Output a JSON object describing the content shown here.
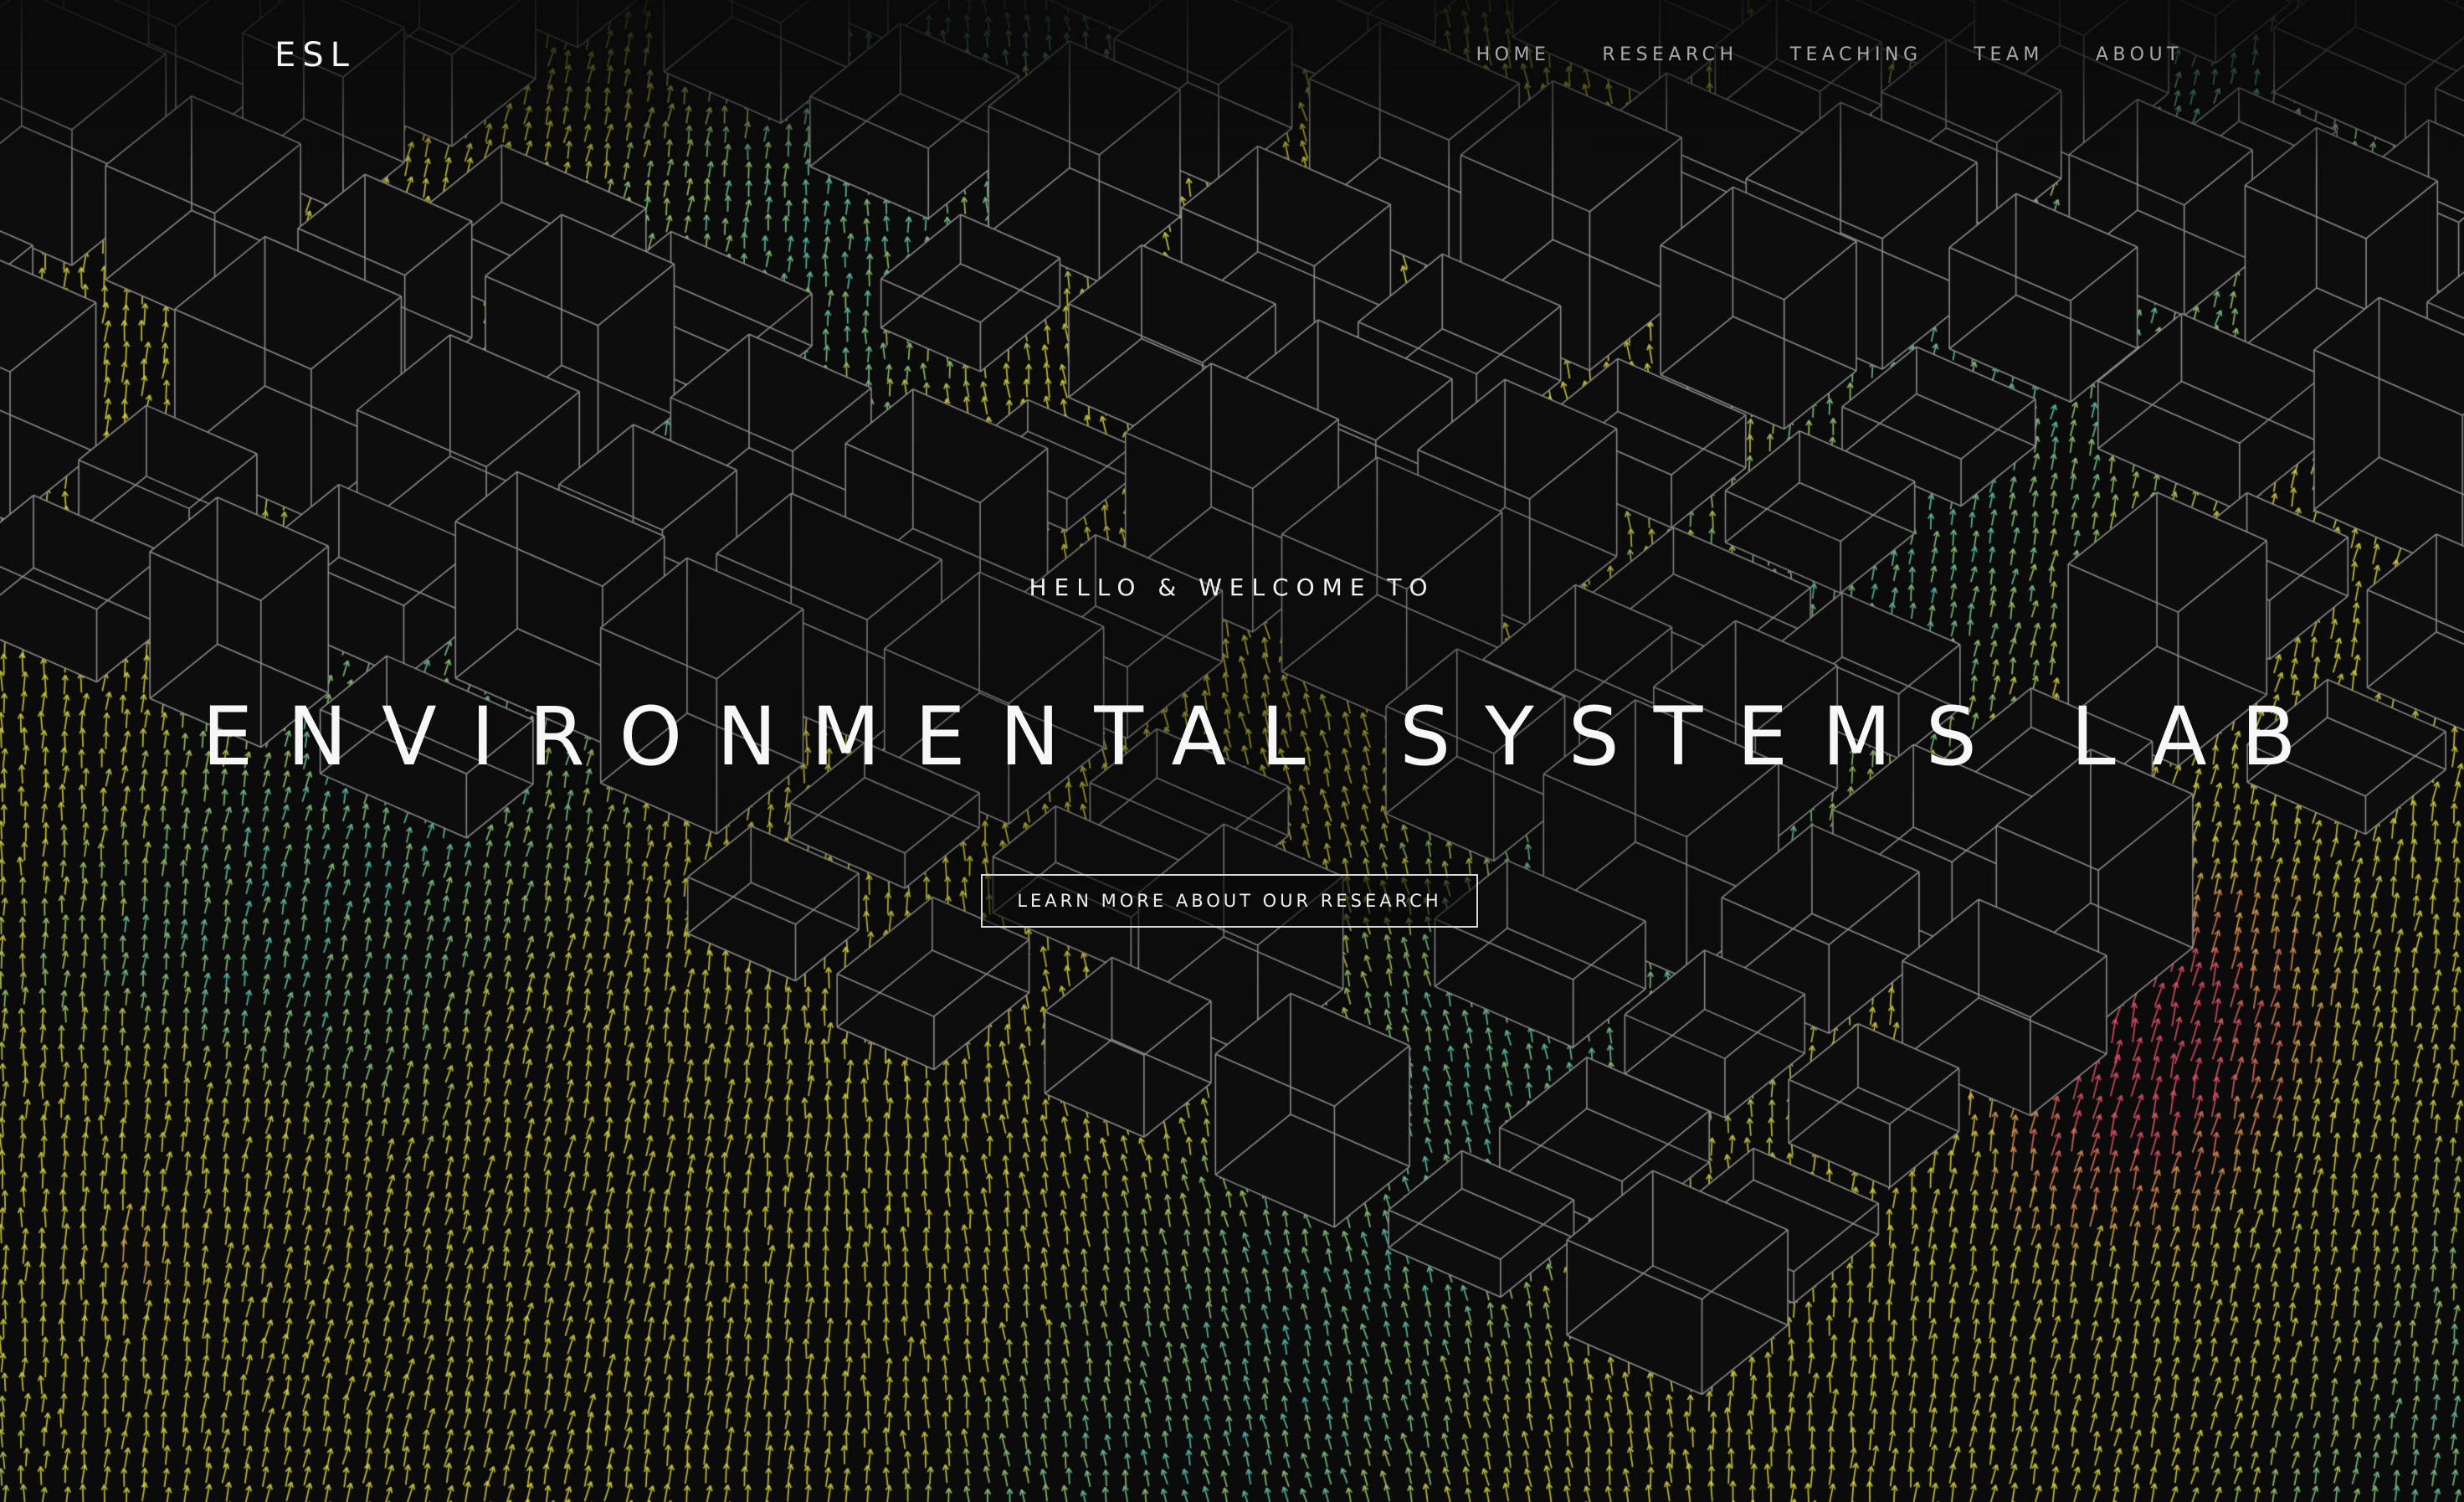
{
  "site": {
    "logo": "ESL"
  },
  "nav": {
    "items": [
      {
        "label": "HOME"
      },
      {
        "label": "RESEARCH"
      },
      {
        "label": "TEACHING"
      },
      {
        "label": "TEAM"
      },
      {
        "label": "ABOUT"
      }
    ]
  },
  "hero": {
    "eyebrow": "HELLO & WELCOME TO",
    "title": "ENVIRONMENTAL SYSTEMS LAB",
    "cta_label": "LEARN MORE ABOUT OUR RESEARCH",
    "background": {
      "description_icon": "wind-flow-arrows-over-building-wireframe",
      "colors": {
        "page_bg": "#0b0b0b",
        "wireframe": "#8a8a8a",
        "arrow_low": "#3fc1c9",
        "arrow_mid": "#d8d23a",
        "arrow_high": "#e0506a"
      }
    }
  }
}
